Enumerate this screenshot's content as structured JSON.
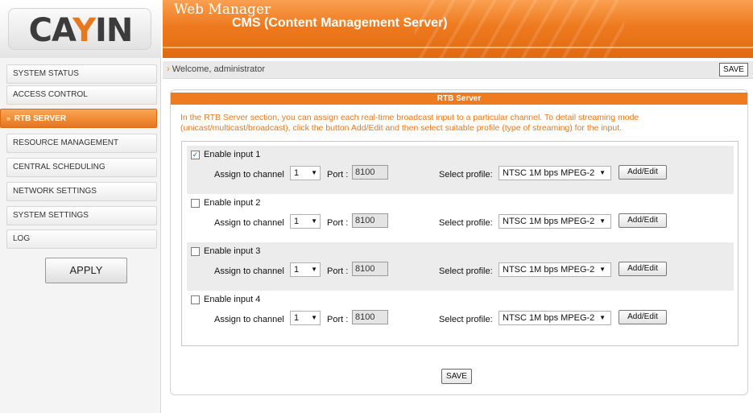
{
  "header": {
    "logo": "CAYIN",
    "app_title": "Web Manager",
    "app_subtitle": "CMS (Content Management Server)",
    "icons": [
      "logout-icon",
      "key-icon",
      "tools-icon"
    ],
    "accent_color": "#ef7b20"
  },
  "sidebar": {
    "items": [
      {
        "label": "SYSTEM STATUS",
        "active": false
      },
      {
        "label": "ACCESS CONTROL",
        "active": false
      },
      {
        "label": "RTB SERVER",
        "active": true
      },
      {
        "label": "RESOURCE MANAGEMENT",
        "active": false
      },
      {
        "label": "CENTRAL SCHEDULING",
        "active": false
      },
      {
        "label": "NETWORK SETTINGS",
        "active": false
      },
      {
        "label": "SYSTEM SETTINGS",
        "active": false
      },
      {
        "label": "LOG",
        "active": false
      }
    ],
    "apply_label": "APPLY"
  },
  "welcome": {
    "text": "Welcome, administrator",
    "save_label": "SAVE"
  },
  "panel": {
    "title": "RTB Server",
    "intro": "In the RTB Server section, you can assign each real-time broadcast input to a particular channel. To detail streaming mode (unicast/multicast/broadcast), click the button Add/Edit and then select suitable profile (type of streaming) for the input.",
    "inputs": [
      {
        "enable_label": "Enable input 1",
        "checked": true,
        "assign_label": "Assign to channel",
        "channel": "1",
        "port_label": "Port :",
        "port": "8100",
        "profile_label": "Select profile:",
        "profile": "NTSC 1M bps MPEG-2",
        "button_label": "Add/Edit"
      },
      {
        "enable_label": "Enable input 2",
        "checked": false,
        "assign_label": "Assign to channel",
        "channel": "1",
        "port_label": "Port :",
        "port": "8100",
        "profile_label": "Select profile:",
        "profile": "NTSC 1M bps MPEG-2",
        "button_label": "Add/Edit"
      },
      {
        "enable_label": "Enable input 3",
        "checked": false,
        "assign_label": "Assign to channel",
        "channel": "1",
        "port_label": "Port :",
        "port": "8100",
        "profile_label": "Select profile:",
        "profile": "NTSC 1M bps MPEG-2",
        "button_label": "Add/Edit"
      },
      {
        "enable_label": "Enable input 4",
        "checked": false,
        "assign_label": "Assign to channel",
        "channel": "1",
        "port_label": "Port :",
        "port": "8100",
        "profile_label": "Select profile:",
        "profile": "NTSC 1M bps MPEG-2",
        "button_label": "Add/Edit"
      }
    ],
    "save_label": "SAVE"
  }
}
